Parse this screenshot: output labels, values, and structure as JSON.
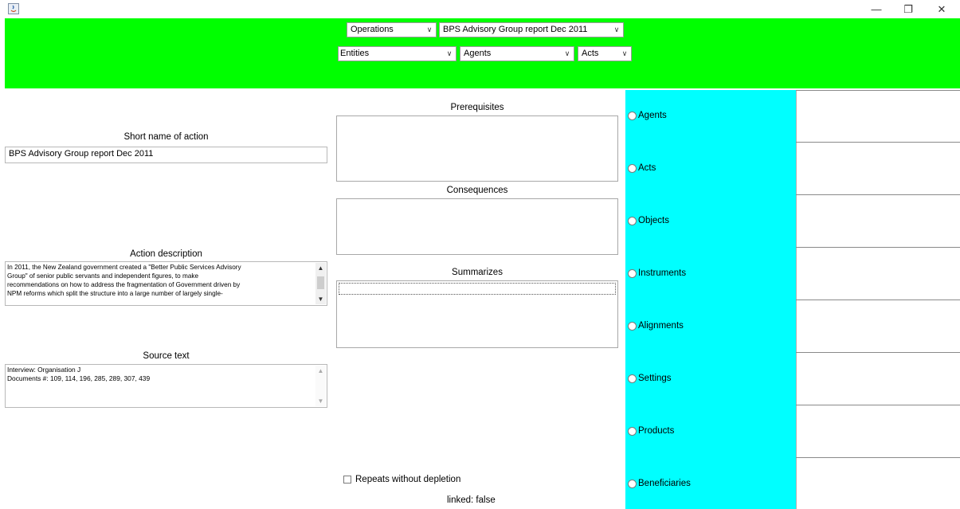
{
  "window": {
    "minimize": "—",
    "restore": "❐",
    "close": "✕"
  },
  "header": {
    "operations_value": "Operations",
    "report_value": "BPS Advisory Group report Dec 2011",
    "entities_value": "Entities",
    "agents_value": "Agents",
    "acts_value": "Acts"
  },
  "left": {
    "short_name_label": "Short name of action",
    "short_name_value": "BPS Advisory Group report Dec 2011",
    "description_label": "Action description",
    "description_lines": [
      "In 2011, the New Zealand government created a \"Better Public Services Advisory",
      "Group\" of senior public servants and independent figures, to make",
      "recommendations on how to address the fragmentation of Government driven by",
      "NPM reforms which split the structure into a large number of largely single-"
    ],
    "source_label": "Source text",
    "source_lines": [
      "Interview: Organisation J",
      "Documents #: 109, 114, 196, 285, 289, 307, 439"
    ]
  },
  "middle": {
    "prerequisites_label": "Prerequisites",
    "consequences_label": "Consequences",
    "summarizes_label": "Summarizes",
    "repeats_label": "Repeats without depletion",
    "linked_label": "linked:  false"
  },
  "roles": [
    "Agents",
    "Acts",
    "Objects",
    "Instruments",
    "Alignments",
    "Settings",
    "Products",
    "Beneficiaries"
  ],
  "colors": {
    "header_bg": "#00ff00",
    "role_panel_bg": "#00ffff"
  }
}
